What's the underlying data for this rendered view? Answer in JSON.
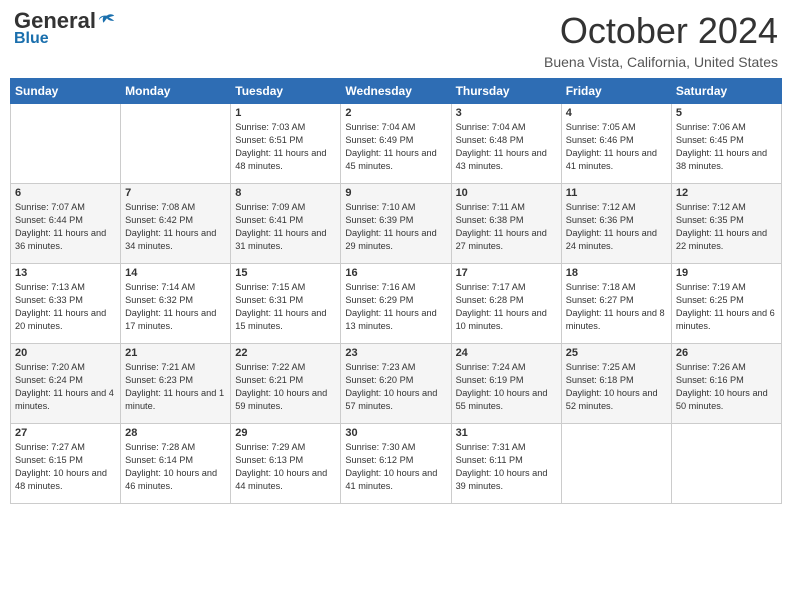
{
  "header": {
    "logo": {
      "general": "General",
      "blue": "Blue"
    },
    "title": "October 2024",
    "location": "Buena Vista, California, United States"
  },
  "weekdays": [
    "Sunday",
    "Monday",
    "Tuesday",
    "Wednesday",
    "Thursday",
    "Friday",
    "Saturday"
  ],
  "weeks": [
    [
      {
        "day": "",
        "sunrise": "",
        "sunset": "",
        "daylight": ""
      },
      {
        "day": "",
        "sunrise": "",
        "sunset": "",
        "daylight": ""
      },
      {
        "day": "1",
        "sunrise": "Sunrise: 7:03 AM",
        "sunset": "Sunset: 6:51 PM",
        "daylight": "Daylight: 11 hours and 48 minutes."
      },
      {
        "day": "2",
        "sunrise": "Sunrise: 7:04 AM",
        "sunset": "Sunset: 6:49 PM",
        "daylight": "Daylight: 11 hours and 45 minutes."
      },
      {
        "day": "3",
        "sunrise": "Sunrise: 7:04 AM",
        "sunset": "Sunset: 6:48 PM",
        "daylight": "Daylight: 11 hours and 43 minutes."
      },
      {
        "day": "4",
        "sunrise": "Sunrise: 7:05 AM",
        "sunset": "Sunset: 6:46 PM",
        "daylight": "Daylight: 11 hours and 41 minutes."
      },
      {
        "day": "5",
        "sunrise": "Sunrise: 7:06 AM",
        "sunset": "Sunset: 6:45 PM",
        "daylight": "Daylight: 11 hours and 38 minutes."
      }
    ],
    [
      {
        "day": "6",
        "sunrise": "Sunrise: 7:07 AM",
        "sunset": "Sunset: 6:44 PM",
        "daylight": "Daylight: 11 hours and 36 minutes."
      },
      {
        "day": "7",
        "sunrise": "Sunrise: 7:08 AM",
        "sunset": "Sunset: 6:42 PM",
        "daylight": "Daylight: 11 hours and 34 minutes."
      },
      {
        "day": "8",
        "sunrise": "Sunrise: 7:09 AM",
        "sunset": "Sunset: 6:41 PM",
        "daylight": "Daylight: 11 hours and 31 minutes."
      },
      {
        "day": "9",
        "sunrise": "Sunrise: 7:10 AM",
        "sunset": "Sunset: 6:39 PM",
        "daylight": "Daylight: 11 hours and 29 minutes."
      },
      {
        "day": "10",
        "sunrise": "Sunrise: 7:11 AM",
        "sunset": "Sunset: 6:38 PM",
        "daylight": "Daylight: 11 hours and 27 minutes."
      },
      {
        "day": "11",
        "sunrise": "Sunrise: 7:12 AM",
        "sunset": "Sunset: 6:36 PM",
        "daylight": "Daylight: 11 hours and 24 minutes."
      },
      {
        "day": "12",
        "sunrise": "Sunrise: 7:12 AM",
        "sunset": "Sunset: 6:35 PM",
        "daylight": "Daylight: 11 hours and 22 minutes."
      }
    ],
    [
      {
        "day": "13",
        "sunrise": "Sunrise: 7:13 AM",
        "sunset": "Sunset: 6:33 PM",
        "daylight": "Daylight: 11 hours and 20 minutes."
      },
      {
        "day": "14",
        "sunrise": "Sunrise: 7:14 AM",
        "sunset": "Sunset: 6:32 PM",
        "daylight": "Daylight: 11 hours and 17 minutes."
      },
      {
        "day": "15",
        "sunrise": "Sunrise: 7:15 AM",
        "sunset": "Sunset: 6:31 PM",
        "daylight": "Daylight: 11 hours and 15 minutes."
      },
      {
        "day": "16",
        "sunrise": "Sunrise: 7:16 AM",
        "sunset": "Sunset: 6:29 PM",
        "daylight": "Daylight: 11 hours and 13 minutes."
      },
      {
        "day": "17",
        "sunrise": "Sunrise: 7:17 AM",
        "sunset": "Sunset: 6:28 PM",
        "daylight": "Daylight: 11 hours and 10 minutes."
      },
      {
        "day": "18",
        "sunrise": "Sunrise: 7:18 AM",
        "sunset": "Sunset: 6:27 PM",
        "daylight": "Daylight: 11 hours and 8 minutes."
      },
      {
        "day": "19",
        "sunrise": "Sunrise: 7:19 AM",
        "sunset": "Sunset: 6:25 PM",
        "daylight": "Daylight: 11 hours and 6 minutes."
      }
    ],
    [
      {
        "day": "20",
        "sunrise": "Sunrise: 7:20 AM",
        "sunset": "Sunset: 6:24 PM",
        "daylight": "Daylight: 11 hours and 4 minutes."
      },
      {
        "day": "21",
        "sunrise": "Sunrise: 7:21 AM",
        "sunset": "Sunset: 6:23 PM",
        "daylight": "Daylight: 11 hours and 1 minute."
      },
      {
        "day": "22",
        "sunrise": "Sunrise: 7:22 AM",
        "sunset": "Sunset: 6:21 PM",
        "daylight": "Daylight: 10 hours and 59 minutes."
      },
      {
        "day": "23",
        "sunrise": "Sunrise: 7:23 AM",
        "sunset": "Sunset: 6:20 PM",
        "daylight": "Daylight: 10 hours and 57 minutes."
      },
      {
        "day": "24",
        "sunrise": "Sunrise: 7:24 AM",
        "sunset": "Sunset: 6:19 PM",
        "daylight": "Daylight: 10 hours and 55 minutes."
      },
      {
        "day": "25",
        "sunrise": "Sunrise: 7:25 AM",
        "sunset": "Sunset: 6:18 PM",
        "daylight": "Daylight: 10 hours and 52 minutes."
      },
      {
        "day": "26",
        "sunrise": "Sunrise: 7:26 AM",
        "sunset": "Sunset: 6:16 PM",
        "daylight": "Daylight: 10 hours and 50 minutes."
      }
    ],
    [
      {
        "day": "27",
        "sunrise": "Sunrise: 7:27 AM",
        "sunset": "Sunset: 6:15 PM",
        "daylight": "Daylight: 10 hours and 48 minutes."
      },
      {
        "day": "28",
        "sunrise": "Sunrise: 7:28 AM",
        "sunset": "Sunset: 6:14 PM",
        "daylight": "Daylight: 10 hours and 46 minutes."
      },
      {
        "day": "29",
        "sunrise": "Sunrise: 7:29 AM",
        "sunset": "Sunset: 6:13 PM",
        "daylight": "Daylight: 10 hours and 44 minutes."
      },
      {
        "day": "30",
        "sunrise": "Sunrise: 7:30 AM",
        "sunset": "Sunset: 6:12 PM",
        "daylight": "Daylight: 10 hours and 41 minutes."
      },
      {
        "day": "31",
        "sunrise": "Sunrise: 7:31 AM",
        "sunset": "Sunset: 6:11 PM",
        "daylight": "Daylight: 10 hours and 39 minutes."
      },
      {
        "day": "",
        "sunrise": "",
        "sunset": "",
        "daylight": ""
      },
      {
        "day": "",
        "sunrise": "",
        "sunset": "",
        "daylight": ""
      }
    ]
  ]
}
